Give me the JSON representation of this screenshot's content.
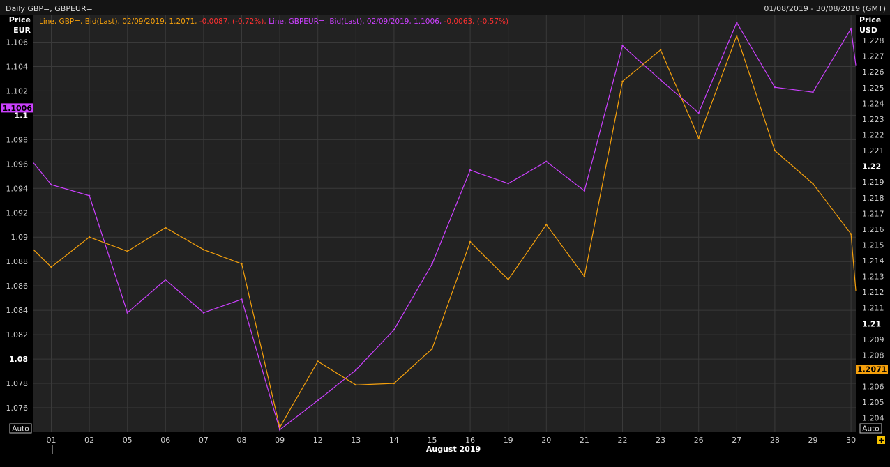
{
  "header": {
    "title": "Daily GBP=, GBPEUR=",
    "date_range": "01/08/2019 - 30/08/2019 (GMT)"
  },
  "legend": {
    "gbp": {
      "prefix": "Line, GBP=, Bid(Last), 02/09/2019, 1.2071, ",
      "change": "-0.0087, (-0.72%),"
    },
    "gbpeur": {
      "prefix": " Line, GBPEUR=, Bid(Last), 02/09/2019, 1.1006, ",
      "change": "-0.0063, (-0.57%)"
    }
  },
  "left_axis": {
    "title_line1": "Price",
    "title_line2": "EUR",
    "auto_label": "Auto",
    "last_value_tag": "1.1006"
  },
  "right_axis": {
    "title_line1": "Price",
    "title_line2": "USD",
    "auto_label": "Auto",
    "last_value_tag": "1.2071"
  },
  "colors": {
    "background": "#000000",
    "plot_background": "#222222",
    "grid": "#3a3a3a",
    "gbp": "#f5a00c",
    "gbpeur": "#cc40ff",
    "negative": "#ff3030"
  },
  "chart_data": {
    "type": "line",
    "xlabel": "August 2019",
    "categories": [
      "01",
      "02",
      "05",
      "06",
      "07",
      "08",
      "09",
      "12",
      "13",
      "14",
      "15",
      "16",
      "19",
      "20",
      "21",
      "22",
      "23",
      "26",
      "27",
      "28",
      "29",
      "30"
    ],
    "left_axis_ylim": [
      1.074,
      1.1082
    ],
    "right_axis_ylim": [
      1.2031,
      1.2296
    ],
    "left_ticks": [
      "1.076",
      "1.078",
      "1.08",
      "1.082",
      "1.084",
      "1.086",
      "1.088",
      "1.09",
      "1.092",
      "1.094",
      "1.096",
      "1.098",
      "1.1",
      "1.102",
      "1.104",
      "1.106"
    ],
    "left_ticks_bold": [
      "1.08",
      "1.1"
    ],
    "right_ticks": [
      "1.204",
      "1.205",
      "1.206",
      "1.207",
      "1.208",
      "1.209",
      "1.21",
      "1.211",
      "1.212",
      "1.213",
      "1.214",
      "1.215",
      "1.216",
      "1.217",
      "1.218",
      "1.219",
      "1.22",
      "1.221",
      "1.222",
      "1.223",
      "1.224",
      "1.225",
      "1.226",
      "1.227",
      "1.228"
    ],
    "right_ticks_bold": [
      "1.21",
      "1.22"
    ],
    "grid": true,
    "series": [
      {
        "name": "GBPEUR=",
        "axis": "left",
        "start_value": 1.0961,
        "values": [
          1.0943,
          1.0934,
          1.0838,
          1.0865,
          1.0838,
          1.0849,
          1.0742,
          1.0766,
          1.0791,
          1.0824,
          1.0878,
          1.0955,
          1.0944,
          1.0962,
          1.0938,
          1.1057,
          1.1029,
          1.1002,
          1.1076,
          1.1023,
          1.1019,
          1.1071
        ],
        "end_value": 1.1041
      },
      {
        "name": "GBP=",
        "axis": "right",
        "start_value": 1.2147,
        "values": [
          1.2136,
          1.2155,
          1.2146,
          1.2161,
          1.2147,
          1.2138,
          1.2034,
          1.2076,
          1.2061,
          1.2062,
          1.2084,
          1.2152,
          1.2128,
          1.2163,
          1.213,
          1.2254,
          1.2274,
          1.2218,
          1.2283,
          1.221,
          1.2189,
          1.2157
        ],
        "end_value": 1.2121
      }
    ]
  }
}
